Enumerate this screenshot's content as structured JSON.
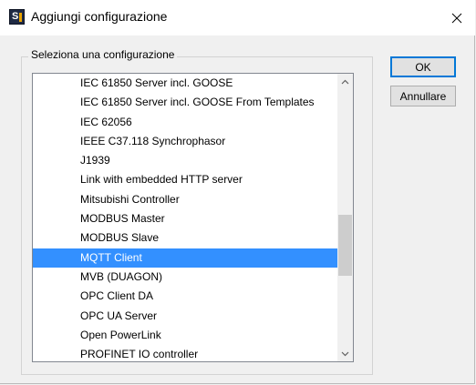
{
  "window": {
    "title": "Aggiungi configurazione",
    "app_icon": "S"
  },
  "group": {
    "label": "Seleziona una configurazione"
  },
  "list": {
    "items": [
      "IEC 61850 Server incl. GOOSE",
      "IEC 61850 Server incl. GOOSE From Templates",
      "IEC 62056",
      "IEEE C37.118 Synchrophasor",
      "J1939",
      "Link with embedded HTTP server",
      "Mitsubishi Controller",
      "MODBUS Master",
      "MODBUS Slave",
      "MQTT Client",
      "MVB (DUAGON)",
      "OPC Client DA",
      "OPC UA Server",
      "Open PowerLink",
      "PROFINET IO controller"
    ],
    "selected": "MQTT Client"
  },
  "buttons": {
    "ok": "OK",
    "cancel": "Annullare"
  },
  "colors": {
    "selection": "#3390ff",
    "default_button_border": "#0078d7"
  }
}
